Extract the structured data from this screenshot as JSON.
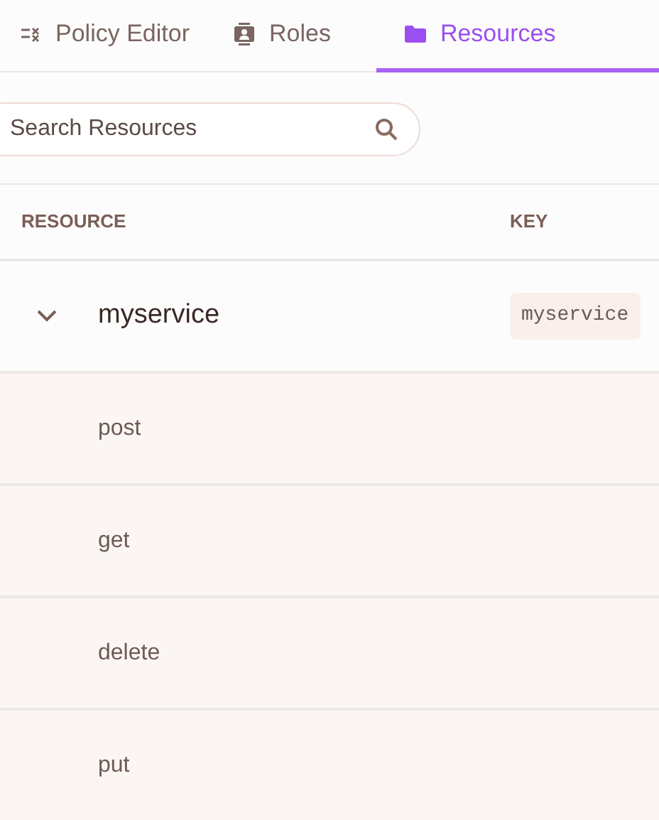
{
  "tabs": [
    {
      "label": "Policy Editor",
      "kind": "policy",
      "selected": false
    },
    {
      "label": "Roles",
      "kind": "roles",
      "selected": false
    },
    {
      "label": "Resources",
      "kind": "resources",
      "selected": true
    }
  ],
  "search": {
    "placeholder": "Search Resources"
  },
  "table": {
    "columns": [
      "RESOURCE",
      "KEY"
    ],
    "rows": [
      {
        "name": "myservice",
        "key": "myservice",
        "expanded": true,
        "children": [
          {
            "name": "post"
          },
          {
            "name": "get"
          },
          {
            "name": "delete"
          },
          {
            "name": "put"
          }
        ]
      }
    ]
  }
}
